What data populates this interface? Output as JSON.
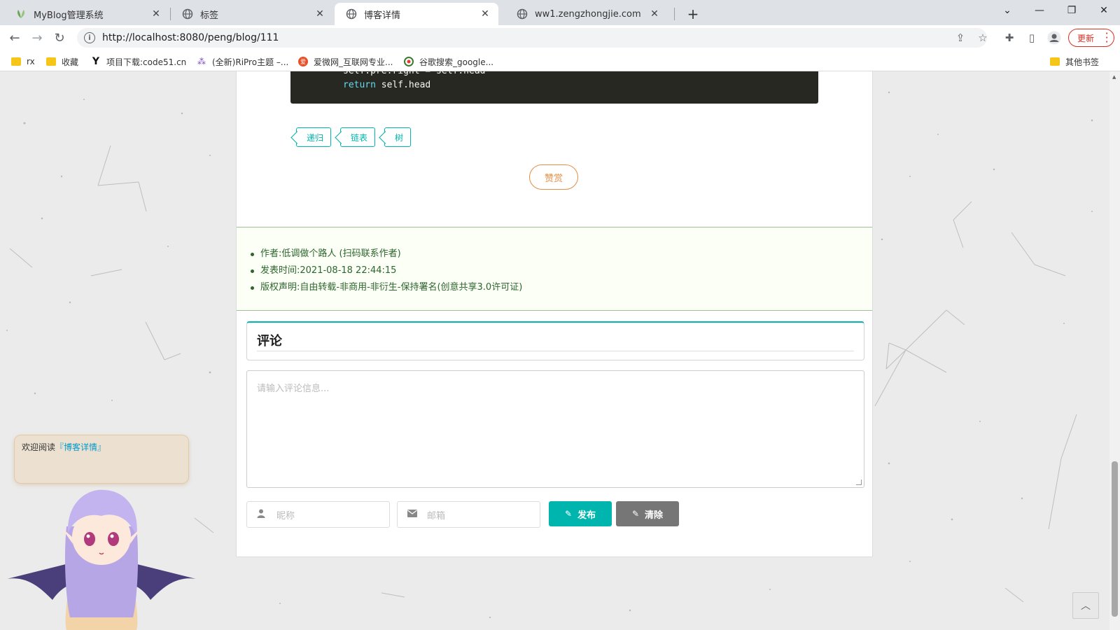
{
  "browser": {
    "tabs": [
      {
        "title": "MyBlog管理系统",
        "icon": "leaf-icon"
      },
      {
        "title": "标签",
        "icon": "globe-icon"
      },
      {
        "title": "博客详情",
        "icon": "globe-icon",
        "active": true
      },
      {
        "title": "ww1.zengzhongjie.com",
        "icon": "globe-icon"
      }
    ],
    "url": "http://localhost:8080/peng/blog/111",
    "update_label": "更新",
    "bookmarks": [
      {
        "label": "rx",
        "icon": "folder-icon"
      },
      {
        "label": "收藏",
        "icon": "folder-icon"
      },
      {
        "label": "项目下载:code51.cn",
        "icon": "y-logo-icon"
      },
      {
        "label": "(全新)RiPro主题 –...",
        "icon": "ripro-icon"
      },
      {
        "label": "爱微网_互联网专业...",
        "icon": "aiwei-icon"
      },
      {
        "label": "谷歌搜索_google...",
        "icon": "360-icon"
      }
    ],
    "other_bookmarks": "其他书签"
  },
  "article": {
    "code_lines": [
      "self.pre.right = self.head",
      "return self.head"
    ],
    "tags": [
      "递归",
      "链表",
      "树"
    ],
    "reward_label": "赞赏",
    "info": [
      "作者:低调做个路人 (扫码联系作者)",
      "发表时间:2021-08-18 22:44:15",
      "版权声明:自由转载-非商用-非衍生-保持署名(创意共享3.0许可证)"
    ]
  },
  "comments": {
    "title": "评论",
    "textarea_placeholder": "请输入评论信息...",
    "nickname_placeholder": "昵称",
    "email_placeholder": "邮箱",
    "publish_label": "发布",
    "clear_label": "清除"
  },
  "mascot": {
    "welcome_prefix": "欢迎阅读",
    "welcome_highlight": "『博客详情』"
  },
  "colors": {
    "accent": "#00b5ad",
    "reward": "#e58e46",
    "info_text": "#2c662d",
    "update": "#d93025"
  }
}
